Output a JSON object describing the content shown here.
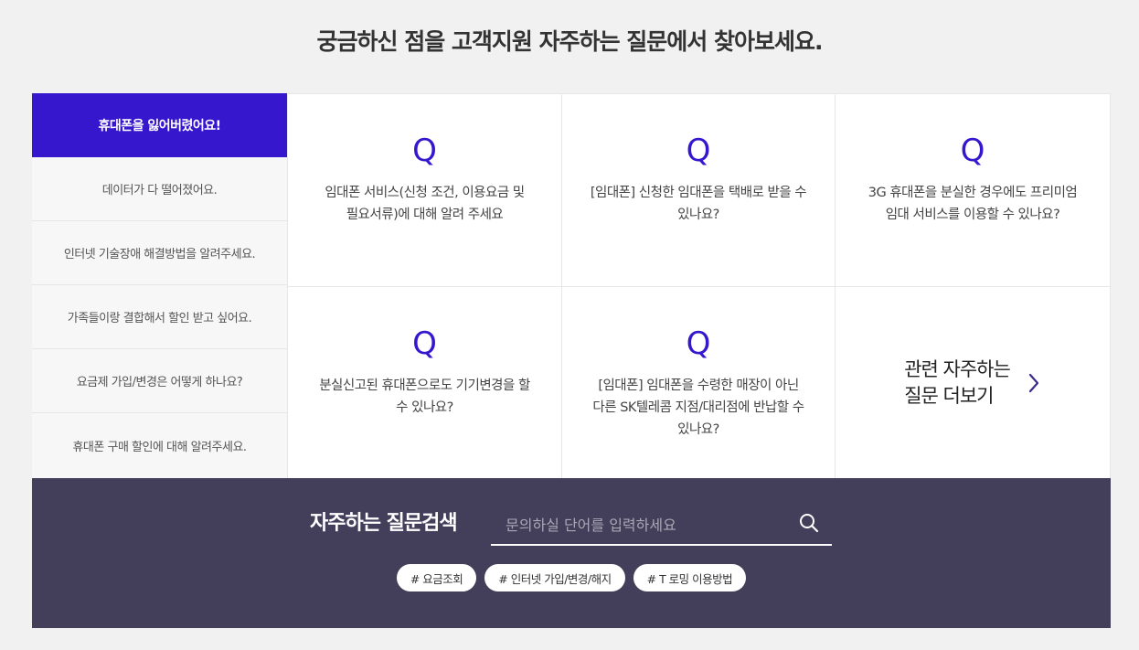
{
  "heading": "궁금하신 점을 고객지원 자주하는 질문에서 찾아보세요.",
  "tabs": [
    {
      "label": "휴대폰을 잃어버렸어요!",
      "active": true
    },
    {
      "label": "데이터가 다 떨어졌어요.",
      "active": false
    },
    {
      "label": "인터넷 기술장애 해결방법을 알려주세요.",
      "active": false
    },
    {
      "label": "가족들이랑 결합해서 할인 받고 싶어요.",
      "active": false
    },
    {
      "label": "요금제 가입/변경은 어떻게 하나요?",
      "active": false
    },
    {
      "label": "휴대폰 구매 할인에 대해 알려주세요.",
      "active": false
    }
  ],
  "questions": [
    {
      "mark": "Q",
      "line1": "임대폰 서비스(신청 조건, 이용요금 및",
      "line2": "필요서류)에 대해 알려 주세요"
    },
    {
      "mark": "Q",
      "line1": "[임대폰] 신청한 임대폰을 택배로 받을 수",
      "line2": "있나요?"
    },
    {
      "mark": "Q",
      "line1": "3G 휴대폰을 분실한 경우에도 프리미엄",
      "line2": "임대 서비스를 이용할 수 있나요?"
    },
    {
      "mark": "Q",
      "line1": "분실신고된 휴대폰으로도 기기변경을 할",
      "line2": "수 있나요?"
    },
    {
      "mark": "Q",
      "line1": "[임대폰] 임대폰을 수령한 매장이 아닌",
      "line2": "다른 SK텔레콤 지점/대리점에 반납할 수",
      "line3": "있나요?"
    }
  ],
  "more": {
    "line1": "관련 자주하는",
    "line2": "질문 더보기",
    "icon": "chevron-right-icon"
  },
  "search": {
    "label": "자주하는 질문검색",
    "placeholder": "문의하실 단어를 입력하세요",
    "icon": "search-icon"
  },
  "tags": [
    "# 요금조회",
    "# 인터넷 가입/변경/해지",
    "# T 로밍 이용방법"
  ],
  "colors": {
    "accent": "#3617ce",
    "search_bg": "#433f5a",
    "page_bg": "#f1f1f1"
  }
}
